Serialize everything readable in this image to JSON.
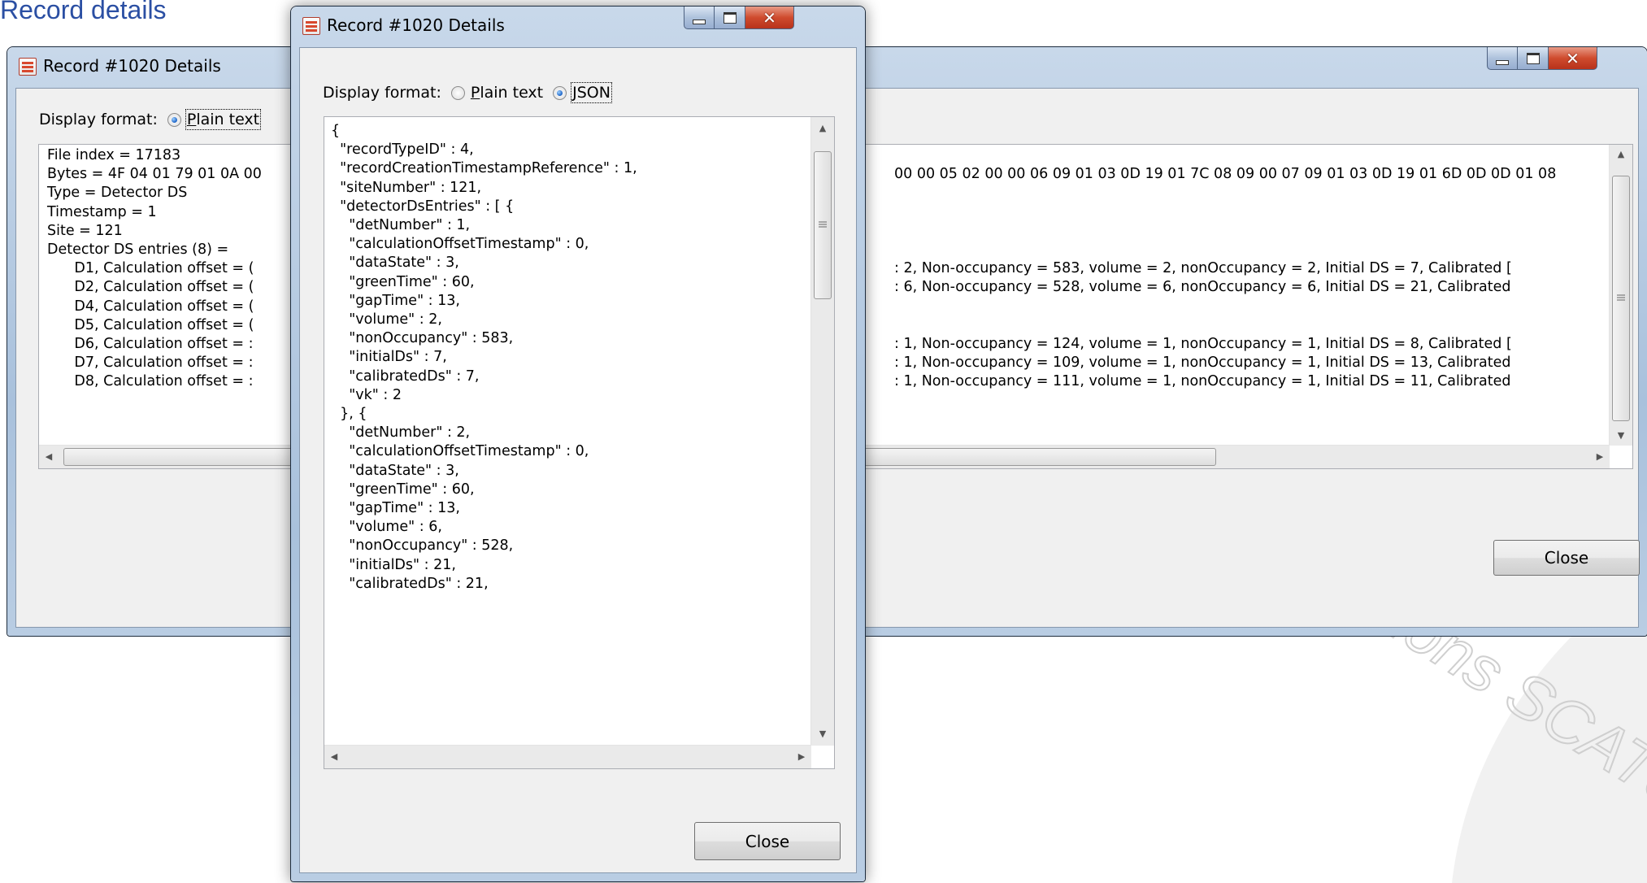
{
  "slide": {
    "title": "Record details"
  },
  "back_window": {
    "title": "Record #1020 Details",
    "display_format_label": "Display format:",
    "options": {
      "plain_text": "Plain text",
      "json": "JSON"
    },
    "selected_format": "plain_text",
    "left_lines": [
      "File index = 17183",
      "Bytes = 4F 04 01 79 01 0A 00",
      "Type = Detector DS",
      "Timestamp = 1",
      "Site = 121",
      "Detector DS entries (8) =",
      "      D1, Calculation offset = (",
      "      D2, Calculation offset = (",
      "      D4, Calculation offset = (",
      "      D5, Calculation offset = (",
      "      D6, Calculation offset = :",
      "      D7, Calculation offset = :",
      "      D8, Calculation offset = :"
    ],
    "right_lines": [
      "",
      "00 00 05 02 00 00 06 09 01 03 0D 19 01 7C 08 09 00 07 09 01 03 0D 19 01 6D 0D 0D 01 08",
      "",
      "",
      "",
      "",
      ": 2, Non-occupancy = 583, volume = 2, nonOccupancy = 2, Initial DS = 7, Calibrated [",
      ": 6, Non-occupancy = 528, volume = 6, nonOccupancy = 6, Initial DS = 21, Calibrated",
      "",
      "",
      ": 1, Non-occupancy = 124, volume = 1, nonOccupancy = 1, Initial DS = 8, Calibrated [",
      ": 1, Non-occupancy = 109, volume = 1, nonOccupancy = 1, Initial DS = 13, Calibrated",
      ": 1, Non-occupancy = 111, volume = 1, nonOccupancy = 1, Initial DS = 11, Calibrated"
    ],
    "close_label": "Close",
    "scroll_position": 0.0
  },
  "front_window": {
    "title": "Record #1020 Details",
    "display_format_label": "Display format:",
    "options": {
      "plain_text": "Plain text",
      "json": "JSON"
    },
    "selected_format": "json",
    "json_lines": [
      "{",
      "  \"recordTypeID\" : 4,",
      "  \"recordCreationTimestampReference\" : 1,",
      "  \"siteNumber\" : 121,",
      "  \"detectorDsEntries\" : [ {",
      "    \"detNumber\" : 1,",
      "    \"calculationOffsetTimestamp\" : 0,",
      "    \"dataState\" : 3,",
      "    \"greenTime\" : 60,",
      "    \"gapTime\" : 13,",
      "    \"volume\" : 2,",
      "    \"nonOccupancy\" : 583,",
      "    \"initialDs\" : 7,",
      "    \"calibratedDs\" : 7,",
      "    \"vk\" : 2",
      "  }, {",
      "    \"detNumber\" : 2,",
      "    \"calculationOffsetTimestamp\" : 0,",
      "    \"dataState\" : 3,",
      "    \"greenTime\" : 60,",
      "    \"gapTime\" : 13,",
      "    \"volume\" : 6,",
      "    \"nonOccupancy\" : 528,",
      "    \"initialDs\" : 21,",
      "    \"calibratedDs\" : 21,"
    ],
    "close_label": "Close",
    "scroll_position": 0.0
  },
  "watermark": {
    "text": "Solutions SCATS"
  },
  "icons": {
    "window_icon": "record-details-icon",
    "minimize": "minimize-icon",
    "maximize": "maximize-icon",
    "close": "close-icon"
  },
  "colors": {
    "slide_title": "#2b4fa3",
    "close_caption": "#cf4b2e",
    "frame": "#a9c1dc"
  }
}
